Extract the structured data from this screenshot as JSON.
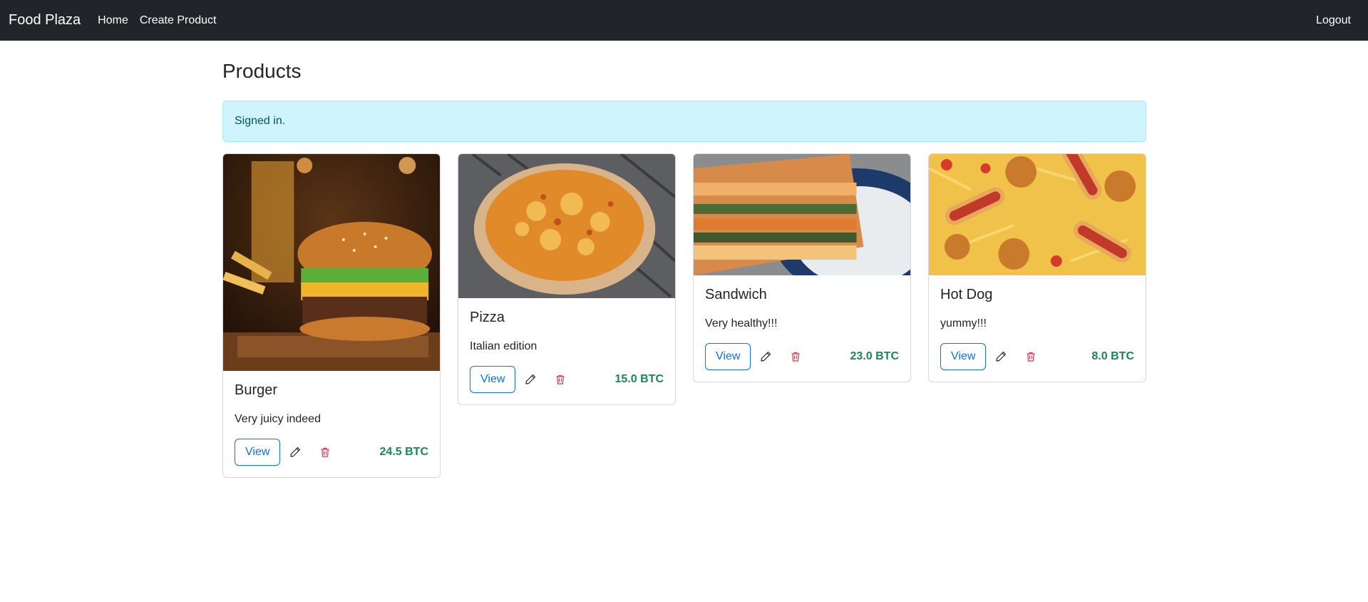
{
  "nav": {
    "brand": "Food Plaza",
    "home": "Home",
    "create": "Create Product",
    "logout": "Logout"
  },
  "page_title": "Products",
  "alert": "Signed in.",
  "icons": {
    "edit": "pencil-icon",
    "delete": "trash-icon"
  },
  "colors": {
    "navbar": "#212529",
    "alert_bg": "#cff4fc",
    "alert_text": "#055160",
    "view_button": "#0d6efd",
    "price": "#198754",
    "delete_icon": "#dc3545"
  },
  "products": [
    {
      "title": "Burger",
      "description": "Very juicy indeed",
      "view_label": "View",
      "price": "24.5 BTC"
    },
    {
      "title": "Pizza",
      "description": "Italian edition",
      "view_label": "View",
      "price": "15.0 BTC"
    },
    {
      "title": "Sandwich",
      "description": "Very healthy!!!",
      "view_label": "View",
      "price": "23.0 BTC"
    },
    {
      "title": "Hot Dog",
      "description": "yummy!!!",
      "view_label": "View",
      "price": "8.0 BTC"
    }
  ]
}
